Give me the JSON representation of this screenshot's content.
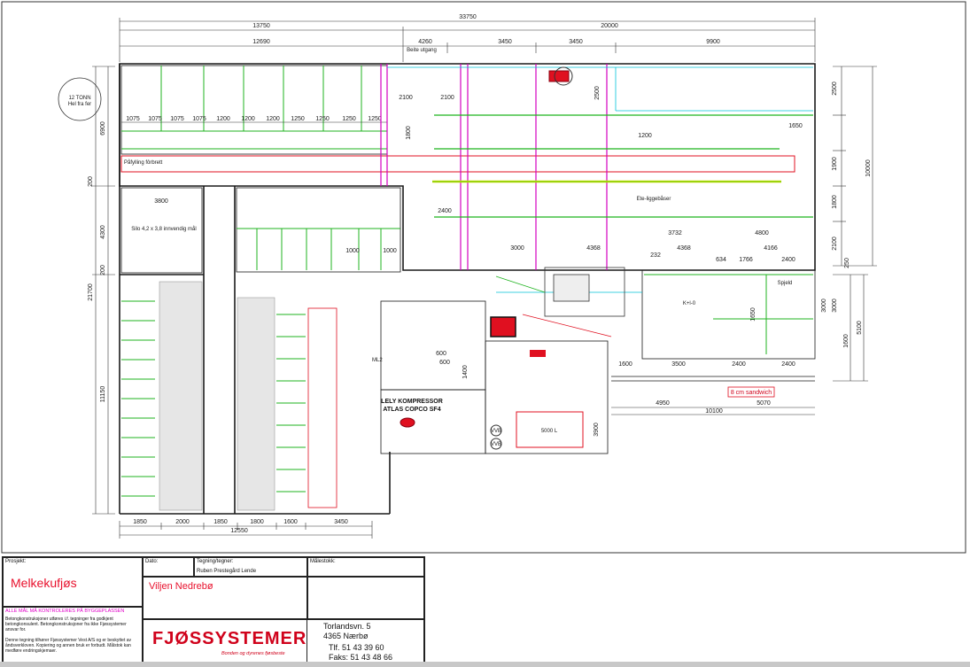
{
  "dimensions": {
    "top": [
      "33750",
      "13750",
      "20000",
      "12690",
      "4260",
      "3450",
      "3450",
      "9900"
    ],
    "left": [
      "6900",
      "200",
      "4300",
      "200",
      "21700",
      "11150"
    ],
    "right": [
      "2500",
      "10000",
      "1900",
      "1800",
      "2100",
      "250",
      "3000",
      "1600",
      "5100"
    ],
    "bottom": [
      "1850",
      "2000",
      "1850",
      "1800",
      "1600",
      "3450",
      "12550"
    ],
    "stall_row": [
      "1075",
      "1075",
      "1075",
      "1075",
      "1200",
      "1200",
      "1200",
      "1250",
      "1250",
      "1250",
      "1250"
    ],
    "interior": [
      "2100",
      "2100",
      "2500",
      "1800",
      "1200",
      "1650",
      "3800",
      "2400",
      "1000",
      "1000",
      "3000",
      "4368",
      "3732",
      "4800",
      "4368",
      "4166",
      "232",
      "634",
      "1766",
      "2400",
      "1650",
      "3000",
      "1600",
      "1600",
      "3500",
      "2400",
      "2400",
      "4950",
      "10100",
      "5070",
      "1400",
      "3900",
      "600",
      "600"
    ]
  },
  "labels": {
    "tank": "12 TONN",
    "tank_sub": "Hel fra fer",
    "feeding": "Påfylling fôrbrett",
    "silo": "Silo 4,2 x 3,8 innvendig mål",
    "stalls": "Ete-liggebåser",
    "beite": "Beite utgang",
    "kalv": "K+l-0",
    "spjeld": "Spjeld",
    "ml2": "ML2",
    "compressor_1": "LELY KOMPRESSOR",
    "compressor_2": "ATLAS COPCO SF4",
    "tank_5000": "5000 L",
    "vvb1": "VVB",
    "vvb2": "VVB",
    "sandwich": "8 cm sandwich"
  },
  "title_block": {
    "prosjekt_label": "Prosjekt:",
    "prosjekt_value": "Melkekufjøs",
    "dato_label": "Dato:",
    "tegning_label": "Tegning/tegner:",
    "tegning_value": "Ruben Prestegård Lende",
    "malestokk_label": "Målestokk:",
    "client": "Viljen Nedrebø",
    "warning": "ALLE MÅL MÅ KONTROLERES PÅ BYGGEPLASSEN",
    "note1": "Betongkonstruksjoner utføres i.f. tegninger fra godkjent betongkonsulent. Betongkonstruksjoner fra ikke Fjøssystemer ansvar for.",
    "note2": "Denne tegning tilhører Fjøssystemer Vest A/S og er beskyttet av åndsverkloven. Kopiering og annen bruk er forbudt. Målstok kan medføre endringskjemaer.",
    "company_logo": "FJØSSYSTEMER",
    "company_slogan": "Bonden og dyrenes fjøsbeste",
    "address1": "Torlandsvn. 5",
    "address2": "4365 Nærbø",
    "tlf": "Tlf. 51 43 39 60",
    "faks": "Faks: 51 43 48 66"
  },
  "colors": {
    "line": "#1a1a1a",
    "green": "#1fb31f",
    "magenta": "#d400c0",
    "cyan": "#00c3d9",
    "red": "#e01020",
    "yellow": "#e6e600"
  }
}
